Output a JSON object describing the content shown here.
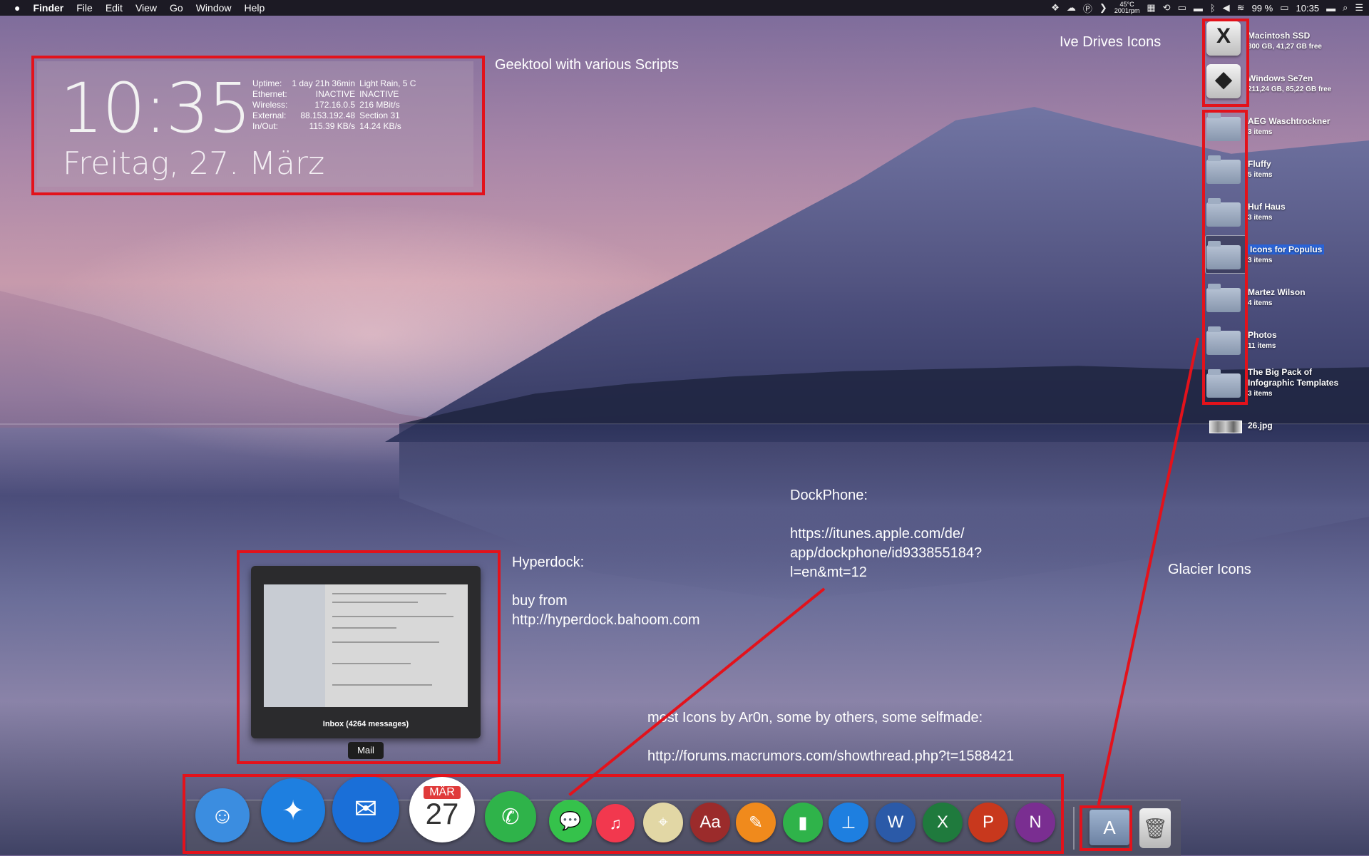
{
  "menubar": {
    "apple": "",
    "app": "Finder",
    "menus": [
      "File",
      "Edit",
      "View",
      "Go",
      "Window",
      "Help"
    ],
    "temp_top": "45°C",
    "temp_bottom": "2001rpm",
    "battery": "99 %",
    "time": "10:35",
    "icons": [
      "dropbox-icon",
      "cloud-icon",
      "parking-icon",
      "chevron-icon",
      "grid-icon",
      "time-machine-icon",
      "airplay-icon",
      "display-icon",
      "bluetooth-icon",
      "volume-icon",
      "wifi-icon",
      "battery-icon",
      "flag-icon",
      "search-icon",
      "list-icon"
    ]
  },
  "geektool": {
    "clock": "10:35",
    "date": "Freitag, 27. März",
    "rows": [
      {
        "label": "Uptime:",
        "value": "1 day 21h 36min",
        "extra": "Light Rain, 5 C"
      },
      {
        "label": "Ethernet:",
        "value": "INACTIVE",
        "extra": "INACTIVE"
      },
      {
        "label": "Wireless:",
        "value": "172.16.0.5",
        "extra": "216 MBit/s"
      },
      {
        "label": "External:",
        "value": "88.153.192.48",
        "extra": "Section 31"
      },
      {
        "label": "In/Out:",
        "value": "115.39 KB/s",
        "extra": "14.24 KB/s"
      }
    ]
  },
  "notes": {
    "geektool": "Geektool with various Scripts",
    "drives": "Ive Drives Icons",
    "dockphone": "DockPhone:\n\nhttps://itunes.apple.com/de/\napp/dockphone/id933855184?\nl=en&mt=12",
    "hyperdock": "Hyperdock:\n\nbuy from\nhttp://hyperdock.bahoom.com",
    "glacier": "Glacier Icons",
    "icons": "most Icons by Ar0n, some by others, some selfmade:\n\nhttp://forums.macrumors.com/showthread.php?t=1588421"
  },
  "drives": [
    {
      "name": "Macintosh SSD",
      "sub": "300 GB, 41,27 GB free",
      "glyph": "X"
    },
    {
      "name": "Windows Se7en",
      "sub": "211,24 GB, 85,22 GB free",
      "glyph": "◆"
    }
  ],
  "folders": [
    {
      "name": "AEG Waschtrockner",
      "sub": "3 items"
    },
    {
      "name": "Fluffy",
      "sub": "5 items"
    },
    {
      "name": "Huf Haus",
      "sub": "3 items"
    },
    {
      "name": "Icons for Populus",
      "sub": "3 items"
    },
    {
      "name": "Martez Wilson",
      "sub": "4 items"
    },
    {
      "name": "Photos",
      "sub": "11 items"
    },
    {
      "name": "The Big Pack of",
      "sub2": "Infographic Templates",
      "sub": "3 items"
    }
  ],
  "file": {
    "name": "26.jpg"
  },
  "preview": {
    "caption": "Inbox (4264 messages)",
    "tooltip": "Mail"
  },
  "calendar": {
    "month": "MÄR",
    "day": "27"
  },
  "dock_apps": [
    {
      "name": "finder",
      "color": "#3b8de0",
      "glyph": "☺"
    },
    {
      "name": "safari",
      "color": "#1e7fe0",
      "glyph": "✦"
    },
    {
      "name": "mail",
      "color": "#1a6fd8",
      "glyph": "✉"
    },
    {
      "name": "calendar",
      "color": "#ffffff",
      "glyph": ""
    },
    {
      "name": "dockphone",
      "color": "#2fb34a",
      "glyph": "✆"
    },
    {
      "name": "messages",
      "color": "#35c24b",
      "glyph": "💬"
    },
    {
      "name": "music",
      "color": "#f2384e",
      "glyph": "♫"
    },
    {
      "name": "maps",
      "color": "#e2d7a5",
      "glyph": "⌖"
    },
    {
      "name": "dictionary",
      "color": "#9b2b2b",
      "glyph": "Aa"
    },
    {
      "name": "pages",
      "color": "#f08a1c",
      "glyph": "✎"
    },
    {
      "name": "numbers",
      "color": "#2fb34a",
      "glyph": "▮"
    },
    {
      "name": "keynote",
      "color": "#1e7fe0",
      "glyph": "⊥"
    },
    {
      "name": "word",
      "color": "#2b5aa8",
      "glyph": "W"
    },
    {
      "name": "excel",
      "color": "#1f7a3d",
      "glyph": "X"
    },
    {
      "name": "powerpoint",
      "color": "#c8381d",
      "glyph": "P"
    },
    {
      "name": "onenote",
      "color": "#7a2e91",
      "glyph": "N"
    }
  ],
  "dock_extra": [
    {
      "name": "applications",
      "glyph": "A"
    },
    {
      "name": "trash",
      "glyph": "🗑"
    }
  ]
}
